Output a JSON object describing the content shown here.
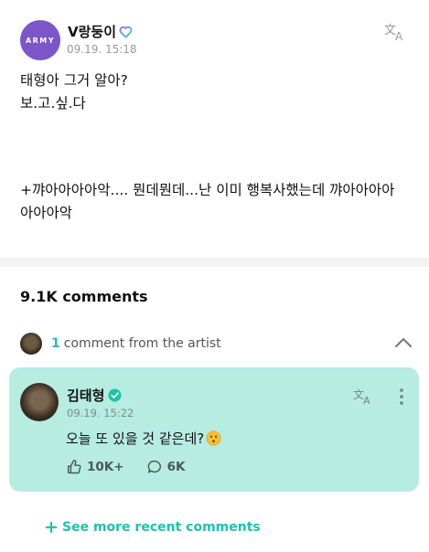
{
  "post": {
    "author_avatar_text": "ARMY",
    "author_name": "V랑둥이",
    "time": "09.19. 15:18",
    "body": "태형아 그거 알아?\n보.고.싶.다",
    "extra_line1": "+꺄아아아아악.... 뭔데뭔데...난 이미 행복사했는데 꺄아아아아",
    "extra_line2": "아아아악"
  },
  "comments": {
    "count_label": "9.1K comments"
  },
  "artist_section": {
    "count": "1",
    "label": "comment from the artist"
  },
  "artist_comment": {
    "name": "김태형",
    "time": "09.19. 15:22",
    "text": "오늘 또 있을 것 같은데?",
    "likes": "10K+",
    "replies": "6K"
  },
  "see_more": {
    "label": "See more recent comments"
  },
  "colors": {
    "accent": "#1ec2ae",
    "card_bg": "#b7ece1",
    "army_purple": "#7c55c9"
  }
}
